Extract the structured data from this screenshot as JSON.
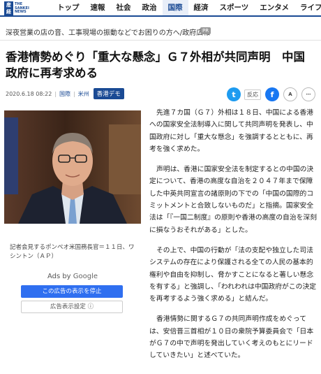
{
  "logo": {
    "mark_text": "産経",
    "brand_text": "THE SANKEI NEWS"
  },
  "nav": {
    "items": [
      {
        "label": "トップ",
        "active": false
      },
      {
        "label": "速報",
        "active": false
      },
      {
        "label": "社会",
        "active": false
      },
      {
        "label": "政治",
        "active": false
      },
      {
        "label": "国際",
        "active": true
      },
      {
        "label": "経済",
        "active": false
      },
      {
        "label": "スポーツ",
        "active": false
      },
      {
        "label": "エンタメ",
        "active": false
      },
      {
        "label": "ライフ",
        "active": false
      }
    ]
  },
  "pr_bar": {
    "text": "深夜営業の店の音、工事現場の振動などでお困りの方へ/政府広報",
    "badge": "PR"
  },
  "headline": "香港情勢めぐり「重大な懸念」Ｇ７外相が共同声明　中国政府に再考求める",
  "meta": {
    "date": "2020.6.18 08:22",
    "section1": "国際",
    "section2": "米州",
    "tag": "香港デモ"
  },
  "social": {
    "twitter_icon": "t",
    "hanno_label": "反応",
    "facebook_icon": "f",
    "font_size_icon": "A",
    "share_icon": "⋯"
  },
  "photo": {
    "caption": "記者会見するポンペオ米国務長官＝１１日、ワシントン（ＡＰ）"
  },
  "ad": {
    "label_prefix": "Ads by",
    "label_brand": "Google",
    "stop_button": "この広告の表示を停止",
    "settings_button": "広告表示設定 ⓘ"
  },
  "article": {
    "paragraphs": [
      "先進７カ国（Ｇ７）外相は１８日、中国による香港への国家安全法制導入に関して共同声明を発表し、中国政府に対し「重大な懸念」を強調するとともに、再考を強く求めた。",
      "声明は、香港に国家安全法を制定するとの中国の決定について、香港の高度な自治を２０４７年まで保障した中英共同宣言の諸原則の下での「中国の国際的コミットメントと合致しないものだ」と指摘。国家安全法は「『一国二制度』の原則や香港の高度の自治を深刻に損なうおそれがある」とした。",
      "その上で、中国の行動が「法の支配や独立した司法システムの存在により保護される全ての人民の基本的権利や自由を抑制し、脅かすことになると著しい懸念を有する」と強調し、「われわれは中国政府がこの決定を再考するよう強く求める」と結んだ。",
      "香港情勢に関するＧ７の共同声明作成をめぐっては、安倍晋三首相が１０日の衆院予算委員会で「日本がＧ７の中で声明を発出していく考えのもとにリードしていきたい」と述べていた。"
    ]
  }
}
